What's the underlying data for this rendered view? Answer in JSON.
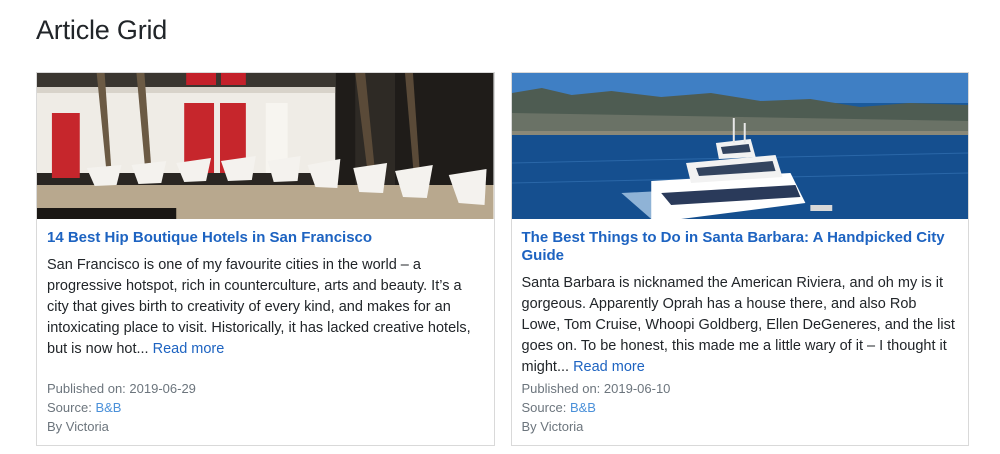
{
  "page": {
    "title": "Article Grid"
  },
  "articles": [
    {
      "image_alt": "Hotel courtyard with white butterfly chairs",
      "title": "14 Best Hip Boutique Hotels in San Francisco",
      "excerpt": "San Francisco is one of my favourite cities in the world – a progressive hotspot, rich in counterculture, arts and beauty. It’s a city that gives birth to creativity of every kind, and makes for an intoxicating place to visit. Historically, it has lacked creative hotels, but is now hot...",
      "read_more": "Read more",
      "published_label": "Published on:",
      "published_date": "2019-06-29",
      "source_label": "Source:",
      "source_name": "B&B",
      "author": "By Victoria"
    },
    {
      "image_alt": "Boat cruising off the coast with mountains behind",
      "title": "The Best Things to Do in Santa Barbara: A Handpicked City Guide",
      "excerpt": "Santa Barbara is nicknamed the American Riviera, and oh my is it gorgeous. Apparently Oprah has a house there, and also Rob Lowe, Tom Cruise, Whoopi Goldberg, Ellen DeGeneres, and the list goes on. To be honest, this made me a little wary of it – I thought it might...",
      "read_more": "Read more",
      "published_label": "Published on:",
      "published_date": "2019-06-10",
      "source_label": "Source:",
      "source_name": "B&B",
      "author": "By Victoria"
    }
  ],
  "colors": {
    "link": "#1d63c1",
    "meta_text": "#6c757d",
    "card_border": "#d9d9d9"
  }
}
